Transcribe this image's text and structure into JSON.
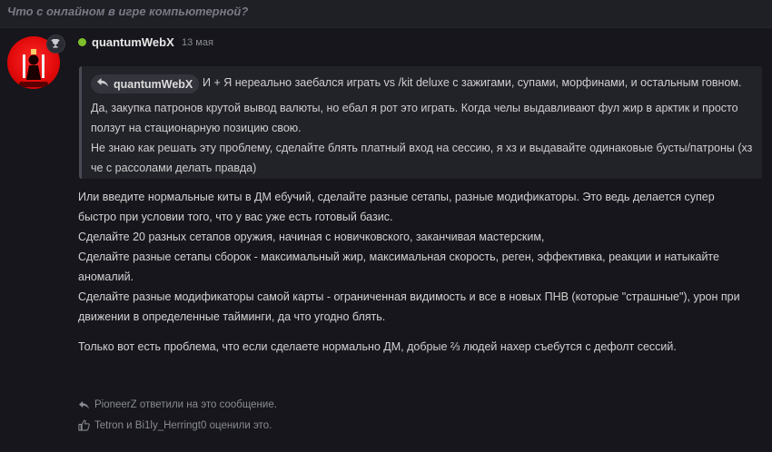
{
  "topic": {
    "title": "Что с онлайном в игре компьютерной?"
  },
  "post": {
    "author": "quantumWebX",
    "date": "13 мая",
    "online_status_color": "#7fbf2a",
    "quote": {
      "author": "quantumWebX",
      "first_line": "И + Я нереально заебался играть vs /kit deluxe с зажигами, супами, морфинами, и остальным говном.",
      "lines": [
        "Да, закупка патронов крутой вывод валюты, но ебал я рот это играть. Когда челы выдавливают фул жир в арктик и просто ползут на стационарную позицию свою.",
        "Не знаю как решать эту проблему, сделайте блять платный вход на сессию, я хз и выдавайте одинаковые бусты/патроны (хз че с рассолами делать правда)"
      ]
    },
    "body": [
      "Или введите нормальные киты в ДМ ебучий, сделайте разные сетапы, разные модификаторы. Это ведь делается супер быстро при условии того, что у вас уже есть готовый базис.",
      "Сделайте 20 разных сетапов оружия, начиная с новичковского, заканчивая мастерским,",
      "Сделайте разные сетапы сборок - максимальный жир, максимальная скорость, реген, эффективка, реакции и натыкайте аномалий.",
      "Сделайте разные модификаторы самой карты - ограниченная видимость и все в новых ПНВ (которые \"страшные\"), урон при движении в определенные тайминги, да что угодно блять."
    ],
    "closing": "Только вот есть проблема, что если сделаете нормально ДМ, добрые ⅔ людей нахер съебутся с дефолт сессий.",
    "reply_note": "PioneerZ ответили на это сообщение.",
    "like_note": "Tetron и Bi1ly_Herringt0 оценили это."
  },
  "icons": {
    "badge": "trophy-icon",
    "quote": "reply-arrow-icon",
    "reply": "reply-arrow-icon",
    "like": "thumbs-up-icon"
  }
}
